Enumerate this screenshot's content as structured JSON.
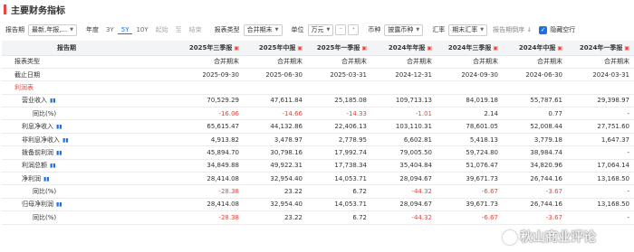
{
  "title": "主要财务指标",
  "toolbar": {
    "report_label": "报告期",
    "report_value": "最新,年报,...",
    "year_label": "年度",
    "year_options": [
      "3Y",
      "5Y",
      "10Y",
      "起始",
      "至",
      "结束"
    ],
    "report_type_label": "报表类型",
    "report_type_value": "合并期末",
    "unit_label": "单位",
    "unit_value": "万元",
    "currency_label": "币种",
    "currency_value": "披露币种",
    "rate_label": "汇率",
    "rate_value": "期末汇率",
    "sort_label": "报告期倒序",
    "hide_empty_label": "隐藏空行"
  },
  "table": {
    "header_label": "报告期",
    "periods": [
      "2025年三季报",
      "2025年中报",
      "2025年一季报",
      "2024年年报",
      "2024年三季报",
      "2024年中报",
      "2024年一季报"
    ],
    "rows": [
      {
        "name": "报表类型",
        "level": "l0",
        "values": [
          "合并期末",
          "合并期末",
          "合并期末",
          "合并期末",
          "合并期末",
          "合并期末",
          "合并期末"
        ],
        "neg": []
      },
      {
        "name": "截止日期",
        "level": "l0",
        "values": [
          "2025-09-30",
          "2025-06-30",
          "2025-03-31",
          "2024-12-31",
          "2024-09-30",
          "2024-06-30",
          "2024-03-31"
        ],
        "neg": []
      },
      {
        "name": "利润表",
        "level": "sect",
        "values": [
          "",
          "",
          "",
          "",
          "",
          "",
          ""
        ],
        "neg": []
      },
      {
        "name": "营业收入",
        "level": "l1",
        "chart": true,
        "values": [
          "70,529.29",
          "47,611.84",
          "25,185.08",
          "109,713.13",
          "84,019.18",
          "55,787.61",
          "29,398.97"
        ],
        "neg": []
      },
      {
        "name": "同比(%)",
        "level": "l2",
        "values": [
          "-16.06",
          "-14.66",
          "-14.33",
          "-1.01",
          "2.14",
          "0.77",
          "-"
        ],
        "neg": [
          0,
          1,
          2,
          3
        ]
      },
      {
        "name": "利息净收入",
        "level": "l1",
        "chart": true,
        "values": [
          "65,615.47",
          "44,132.86",
          "22,406.13",
          "103,110.31",
          "78,601.05",
          "52,008.44",
          "27,751.60"
        ],
        "neg": []
      },
      {
        "name": "非利息净收入",
        "level": "l1",
        "chart": true,
        "values": [
          "4,913.82",
          "3,478.97",
          "2,778.95",
          "6,602.81",
          "5,418.13",
          "3,779.18",
          "1,647.37"
        ],
        "neg": []
      },
      {
        "name": "拨备前利润",
        "level": "l1",
        "chart": true,
        "values": [
          "45,894.70",
          "30,798.16",
          "17,992.74",
          "79,005.50",
          "59,724.80",
          "38,984.74",
          "-"
        ],
        "neg": []
      },
      {
        "name": "利润总额",
        "level": "l1",
        "chart": true,
        "values": [
          "34,849.88",
          "49,922.31",
          "17,738.34",
          "35,404.84",
          "51,076.47",
          "34,820.96",
          "17,064.14"
        ],
        "neg": []
      },
      {
        "name": "净利润",
        "level": "l1",
        "chart": true,
        "values": [
          "28,414.08",
          "32,954.40",
          "14,053.71",
          "28,094.67",
          "39,671.73",
          "26,744.16",
          "13,168.50"
        ],
        "neg": []
      },
      {
        "name": "同比(%)",
        "level": "l2",
        "values": [
          "-28.38",
          "23.22",
          "6.72",
          "-44.32",
          "-6.67",
          "-3.67",
          "-"
        ],
        "neg": [
          0,
          3,
          4,
          5
        ]
      },
      {
        "name": "归母净利润",
        "level": "l1",
        "chart": true,
        "values": [
          "28,414.08",
          "32,954.40",
          "14,053.71",
          "28,094.67",
          "39,671.73",
          "26,744.16",
          "13,168.50"
        ],
        "neg": []
      },
      {
        "name": "同比(%)",
        "level": "l2",
        "values": [
          "-28.38",
          "23.22",
          "6.72",
          "-44.32",
          "-6.67",
          "-3.67",
          "-"
        ],
        "neg": [
          0,
          3,
          4,
          5
        ]
      }
    ]
  },
  "watermark": "秋山商业评论",
  "colors": {
    "accent": "#1f6fe5",
    "negative": "#e8463c",
    "header_bg": "#f3f4f6"
  }
}
